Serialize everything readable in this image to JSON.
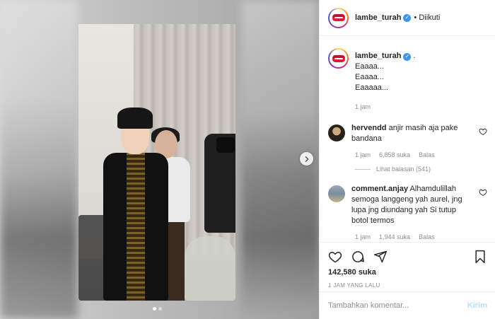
{
  "header": {
    "username": "lambe_turah",
    "follow_status": "• Diikuti"
  },
  "caption": {
    "username": "lambe_turah",
    "suffix": ".",
    "lines": [
      "Eaaaa...",
      "Eaaaa...",
      "Eaaaaa..."
    ],
    "time": "1 jam"
  },
  "comments": [
    {
      "username": "hervendd",
      "text": "anjir masih aja pake bandana",
      "time": "1 jam",
      "likes": "6,858 suka",
      "reply": "Balas",
      "view_replies": "Lihat balasan (541)"
    },
    {
      "username": "comment.anjay",
      "text": "Alhamdulillah semoga langgeng yah aurel, jng lupa jng diundang yah Si tutup botol termos",
      "time": "1 jam",
      "likes": "1,944 suka",
      "reply": "Balas"
    }
  ],
  "post": {
    "likes": "142,580 suka",
    "time_ago": "1 JAM YANG LALU"
  },
  "add_comment": {
    "placeholder": "Tambahkan komentar...",
    "submit": "Kirim"
  },
  "carousel": {
    "slides": 2,
    "active": 0
  },
  "colors": {
    "verified": "#3897f0",
    "submit_disabled": "#b2dffc",
    "muted": "#8e8e8e",
    "text": "#262626"
  },
  "icons": [
    "verified-icon",
    "heart-icon",
    "comment-icon",
    "share-icon",
    "bookmark-icon",
    "chevron-right-icon"
  ]
}
